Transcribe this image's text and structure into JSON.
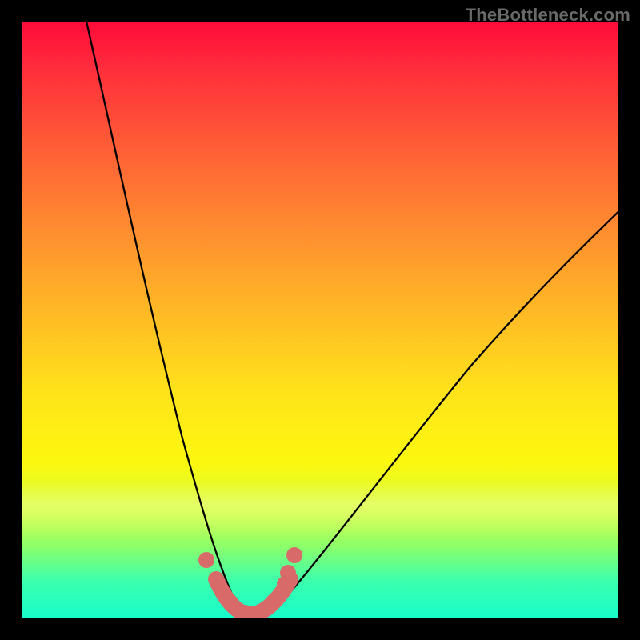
{
  "watermark": "TheBottleneck.com",
  "colors": {
    "background_top": "#ff0b3a",
    "background_mid": "#ffe31a",
    "background_bottom": "#17fecc",
    "curve": "#000000",
    "markers": "#d96a6a",
    "frame": "#000000"
  },
  "chart_data": {
    "type": "line",
    "title": "",
    "xlabel": "",
    "ylabel": "",
    "xlim": [
      0,
      100
    ],
    "ylim": [
      0,
      100
    ],
    "grid": false,
    "legend": false,
    "series": [
      {
        "name": "bottleneck-curve-left",
        "x": [
          10,
          14,
          18,
          22,
          26,
          30,
          32,
          34,
          36
        ],
        "y": [
          100,
          82,
          63,
          44,
          25,
          9,
          4,
          1,
          0
        ]
      },
      {
        "name": "bottleneck-curve-right",
        "x": [
          36,
          40,
          45,
          55,
          65,
          75,
          85,
          95,
          100
        ],
        "y": [
          0,
          1,
          4,
          14,
          27,
          40,
          53,
          64,
          70
        ]
      }
    ],
    "highlighted_region": {
      "name": "optimal-zone",
      "x_range": [
        30,
        44
      ],
      "y_approx": 0,
      "marker_points_x": [
        30.5,
        32,
        34,
        36,
        38,
        41,
        43,
        44
      ],
      "marker_points_y": [
        8,
        4,
        1,
        0,
        0,
        1,
        3,
        6
      ]
    }
  }
}
